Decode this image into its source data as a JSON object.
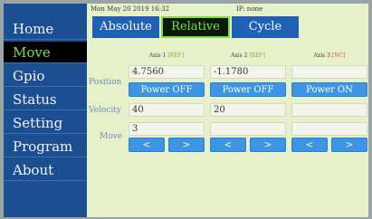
{
  "status": {
    "datetime": "Mon May 20 2019 16:32",
    "ip": "IP: none"
  },
  "tabs": {
    "absolute": "Absolute",
    "relative": "Relative",
    "cycle": "Cycle"
  },
  "sidebar": {
    "items": [
      {
        "label": "Home"
      },
      {
        "label": "Move"
      },
      {
        "label": "Gpio"
      },
      {
        "label": "Status"
      },
      {
        "label": "Setting"
      },
      {
        "label": "Program"
      },
      {
        "label": "About"
      }
    ]
  },
  "axes": [
    {
      "name": "Axis 1",
      "tag": "[REF]",
      "position": "4.7560",
      "power_label": "Power OFF",
      "velocity": "40",
      "move": "3"
    },
    {
      "name": "Axis 2",
      "tag": "[REF]",
      "position": "-1.1780",
      "power_label": "Power OFF",
      "velocity": "20",
      "move": ""
    },
    {
      "name": "Axis 3",
      "tag": "[NC]",
      "position": "",
      "power_label": "Power ON",
      "velocity": "",
      "move": ""
    }
  ],
  "labels": {
    "position": "Position",
    "velocity": "Velocity",
    "move": "Move"
  },
  "move_buttons": {
    "left": "<",
    "right": ">"
  },
  "colors": {
    "sidebar": "#1c4f92",
    "active_green": "#7edc45",
    "button_blue": "#3e95e4",
    "background": "#e7f1c9"
  }
}
